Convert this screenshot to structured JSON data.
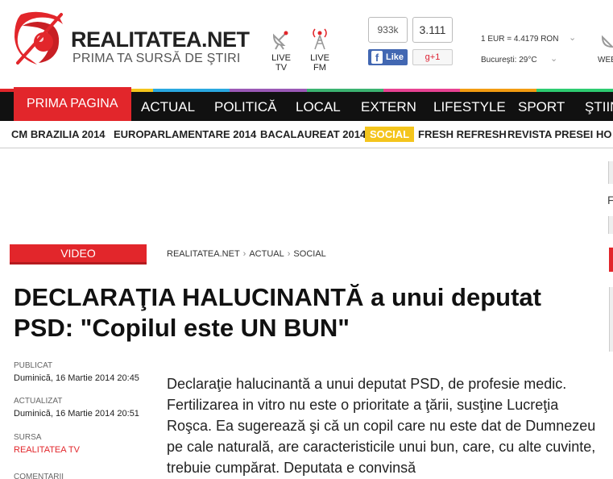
{
  "header": {
    "brand": "REALITATEA.NET",
    "tagline": "PRIMA TA SURSĂ DE ŞTIRI",
    "live_tv": "LIVE TV",
    "live_fm": "LIVE FM",
    "fb_count": "933k",
    "fb_like": "Like",
    "gplus_count": "3.111",
    "gplus_label": "g+1",
    "exchange": "1 EUR = 4.4179 RON",
    "weather": "Bucureşti: 29°C",
    "web_label": "WEB"
  },
  "main_nav": {
    "items": [
      "PRIMA PAGINA",
      "ACTUAL",
      "POLITICĂ",
      "LOCAL",
      "EXTERN",
      "LIFESTYLE",
      "SPORT",
      "ŞTIIN"
    ],
    "color_stripes": [
      "#e2262b",
      "#f4c51d",
      "#2aa8e0",
      "#9b59b6",
      "#3cb371",
      "#e84393",
      "#f39c12",
      "#2ecc71"
    ]
  },
  "sub_nav": {
    "items": [
      "CM BRAZILIA 2014",
      "EUROPARLAMENTARE 2014",
      "BACALAUREAT 2014",
      "SOCIAL",
      "FRESH REFRESH",
      "REVISTA PRESEI",
      "HO"
    ],
    "highlight_color": "#f4c51d"
  },
  "sidebar": {
    "letter": "F"
  },
  "article": {
    "section_tag": "VIDEO",
    "breadcrumb": [
      "REALITATEA.NET",
      "ACTUAL",
      "SOCIAL"
    ],
    "breadcrumb_sep": "›",
    "title": "DECLARAŢIA HALUCINANTĂ a unui deputat PSD: \"Copilul este UN BUN\"",
    "published_label": "PUBLICAT",
    "published_value": "Duminică, 16 Martie 2014 20:45",
    "updated_label": "ACTUALIZAT",
    "updated_value": "Duminică, 16 Martie 2014 20:51",
    "source_label": "SURSA",
    "source_value": "REALITATEA TV",
    "comments_label": "COMENTARII",
    "lead": "Declaraţie halucinantă a unui deputat PSD, de profesie medic. Fertilizarea in vitro nu este o prioritate a ţării, susţine Lucreţia Roşca. Ea sugerează şi că un copil care nu este dat de Dumnezeu pe cale naturală, are caracteristicile unui bun, care, cu alte cuvinte, trebuie cumpărat. Deputata e convinsă"
  },
  "colors": {
    "accent": "#e2262b",
    "nav_bg": "#111111",
    "facebook": "#4267b2"
  }
}
